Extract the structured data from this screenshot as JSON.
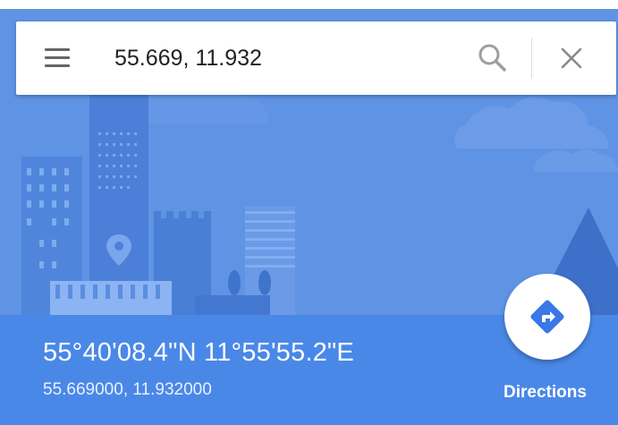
{
  "search": {
    "query": "55.669, 11.932"
  },
  "icons": {
    "menu": "hamburger-menu-icon",
    "search": "search-icon",
    "close": "close-icon",
    "directions": "directions-arrow-icon",
    "hero_pin": "map-pin-icon"
  },
  "location": {
    "dms": "55°40'08.4\"N 11°55'55.2\"E",
    "decimal": "55.669000, 11.932000"
  },
  "actions": {
    "directions_label": "Directions"
  },
  "colors": {
    "hero_bg": "#5f93e4",
    "panel_bg": "#4a88e8",
    "accent": "#3b78e7"
  }
}
